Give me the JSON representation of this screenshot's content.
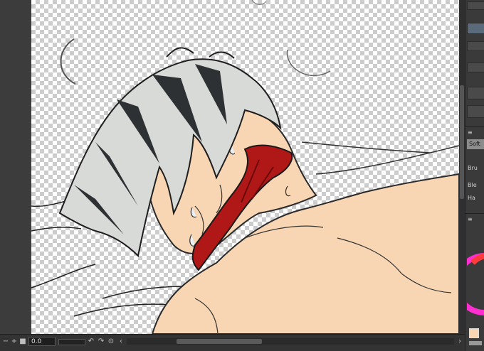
{
  "toolbar": {
    "zoom_value": "0.0"
  },
  "brush_panel": {
    "preset_label": "Soft",
    "row1_label": "Bru",
    "row2_label": "Ble",
    "row3_label": "Ha"
  },
  "icons": {
    "bottom_left": [
      "minus-icon",
      "plus-icon",
      "square-icon"
    ],
    "bottom_nav": [
      "rotate-left-icon",
      "rotate-right-icon",
      "reset-icon",
      "prev-icon",
      "next-icon"
    ]
  },
  "colors": {
    "skin": "#f8d6b4",
    "hair_light": "#d7dad6",
    "hair_dark": "#2e3133",
    "collar": "#b01818",
    "ui_dark": "#3a3a3a"
  }
}
